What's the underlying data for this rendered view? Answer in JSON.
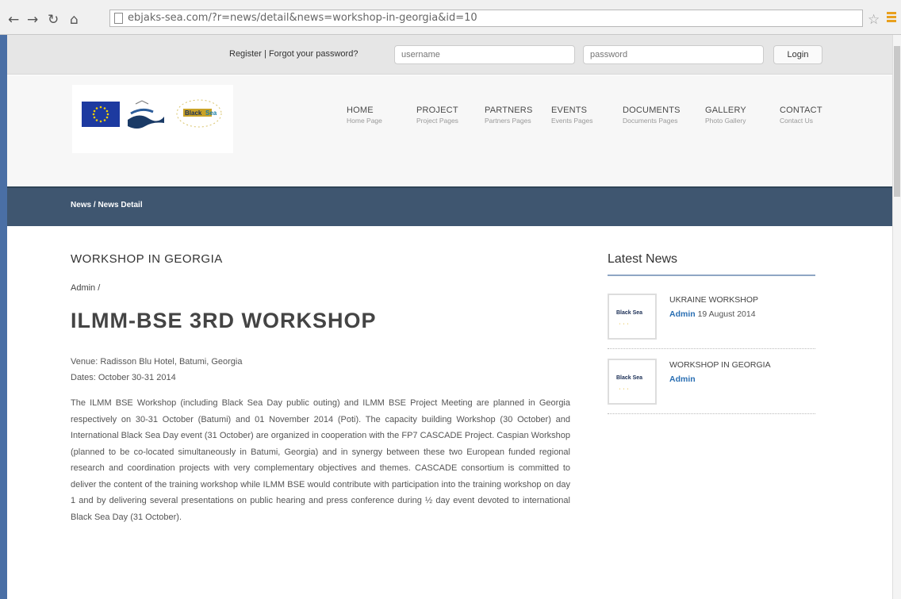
{
  "browser": {
    "url": "ebjaks-sea.com/?r=news/detail&news=workshop-in-georgia&id=10",
    "back_icon": "back-arrow-icon",
    "forward_icon": "forward-arrow-icon",
    "reload_icon": "reload-icon",
    "home_icon": "home-icon"
  },
  "login_bar": {
    "register_link": "Register",
    "separator": "|",
    "forgot_link": "Forgot your password?",
    "username_placeholder": "username",
    "password_placeholder": "password",
    "login_button": "Login"
  },
  "nav": {
    "items": [
      {
        "label": "HOME",
        "sub": "Home Page"
      },
      {
        "label": "PROJECT",
        "sub": "Project Pages"
      },
      {
        "label": "PARTNERS",
        "sub": "Partners Pages"
      },
      {
        "label": "EVENTS",
        "sub": "Events Pages"
      },
      {
        "label": "DOCUMENTS",
        "sub": "Documents Pages"
      },
      {
        "label": "GALLERY",
        "sub": "Photo Gallery"
      },
      {
        "label": "CONTACT",
        "sub": "Contact Us"
      }
    ]
  },
  "breadcrumb": "News / News Detail",
  "article": {
    "category": "WORKSHOP IN GEORGIA",
    "author": "Admin /",
    "title": "ILMM-BSE 3RD WORKSHOP",
    "venue": "Venue: Radisson Blu Hotel, Batumi, Georgia",
    "dates": "Dates: October 30-31 2014",
    "body": "The ILMM BSE Workshop (including Black Sea Day public outing) and ILMM BSE Project Meeting are planned in Georgia respectively on 30-31 October (Batumi) and 01 November 2014 (Poti). The capacity building Workshop (30 October) and International Black Sea Day event (31 October) are organized in cooperation with the FP7 CASCADE Project. Caspian Workshop (planned to be co-located simultaneously in Batumi, Georgia) and in synergy between these two European funded regional research and coordination projects with very complementary objectives and themes. CASCADE consortium is committed to deliver the content of the training workshop while ILMM BSE would contribute with participation into the training workshop on day 1 and by delivering several presentations on public hearing and press conference during ½ day event devoted to international Black Sea Day (31 October)."
  },
  "sidebar": {
    "title": "Latest News",
    "items": [
      {
        "title": "UKRAINE WORKSHOP",
        "author": "Admin",
        "date": "19 August 2014",
        "thumb_text": "Black Sea"
      },
      {
        "title": "WORKSHOP IN GEORGIA",
        "author": "Admin",
        "date": "",
        "thumb_text": "Black Sea"
      }
    ]
  },
  "colors": {
    "band": "#3f5670",
    "accent_link": "#2a6fb3",
    "chrome_edge": "#4a6fa5"
  }
}
